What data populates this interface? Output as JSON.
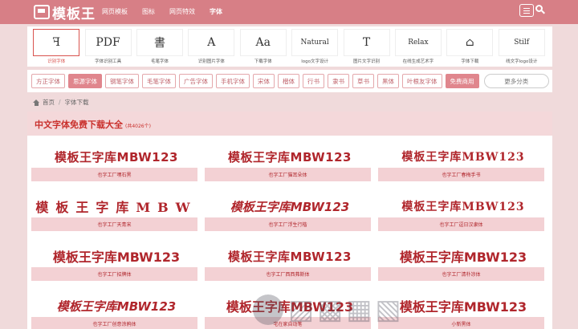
{
  "header": {
    "logo_text": "模板王",
    "nav": [
      "网页模板",
      "图标",
      "网页特效",
      "字体"
    ],
    "active_nav": "字体"
  },
  "featured": [
    {
      "label": "识别字体",
      "art": "ꟻ"
    },
    {
      "label": "字体识别工具",
      "art": "PDF"
    },
    {
      "label": "毛笔字体",
      "art": "書"
    },
    {
      "label": "识别图片字体",
      "art": "A"
    },
    {
      "label": "下载字体",
      "art": "Aa"
    },
    {
      "label": "logo文字设计",
      "art": "Natural"
    },
    {
      "label": "图片文字识别",
      "art": "T"
    },
    {
      "label": "在线生成艺术字",
      "art": "Relax"
    },
    {
      "label": "字体下载",
      "art": "⌂"
    },
    {
      "label": "线文字logo设计",
      "art": "Stilf"
    }
  ],
  "categories": [
    "方正字体",
    "思源字体",
    "钢笔字体",
    "毛笔字体",
    "广告字体",
    "手机字体",
    "宋体",
    "楷体",
    "行书",
    "隶书",
    "草书",
    "黑体",
    "叶根友字体",
    "免费商用",
    "更多分类"
  ],
  "breadcrumb": {
    "home": "首页",
    "current": "字体下载"
  },
  "section": {
    "title": "中文字体免费下载大全",
    "count": "(共4026个)"
  },
  "fonts": [
    {
      "sample": "模板王字库MBW123",
      "name": "也字工厂嘿石黑",
      "style": "s-bold"
    },
    {
      "sample": "模板王字库MBW123",
      "name": "也字工厂猫耳朵体",
      "style": "s-bold"
    },
    {
      "sample": "模板王字库MBW123",
      "name": "也字工厂春梅手书",
      "style": "s-serif"
    },
    {
      "sample": "模板王字库MBW",
      "name": "也字工厂天青宋",
      "style": "s-wide"
    },
    {
      "sample": "模板王字库MBW123",
      "name": "也字工厂浮生行楷",
      "style": "s-hand"
    },
    {
      "sample": "模板王字库MBW123",
      "name": "也字工厂逗日汉隶体",
      "style": "s-serif"
    },
    {
      "sample": "模板王字库MBW123",
      "name": "也字工厂招牌体",
      "style": "s-big"
    },
    {
      "sample": "模板王字库MBW123",
      "name": "也字工厂西西弗斯体",
      "style": "s-bold"
    },
    {
      "sample": "模板王字库MBW123",
      "name": "也字工厂清朴凉体",
      "style": "s-big"
    },
    {
      "sample": "模板王字库MBW123",
      "name": "也字工厂创意涂鸦体",
      "style": "s-hand"
    },
    {
      "sample": "模板王字库MBW123",
      "name": "宅在家自动笔",
      "style": "s-big"
    },
    {
      "sample": "模板王字库MBW123",
      "name": "小新黑体",
      "style": "s-big"
    }
  ],
  "colors": {
    "accent": "#d77f86",
    "title_red": "#c9302c",
    "tag_bg": "#f3d1d4"
  }
}
